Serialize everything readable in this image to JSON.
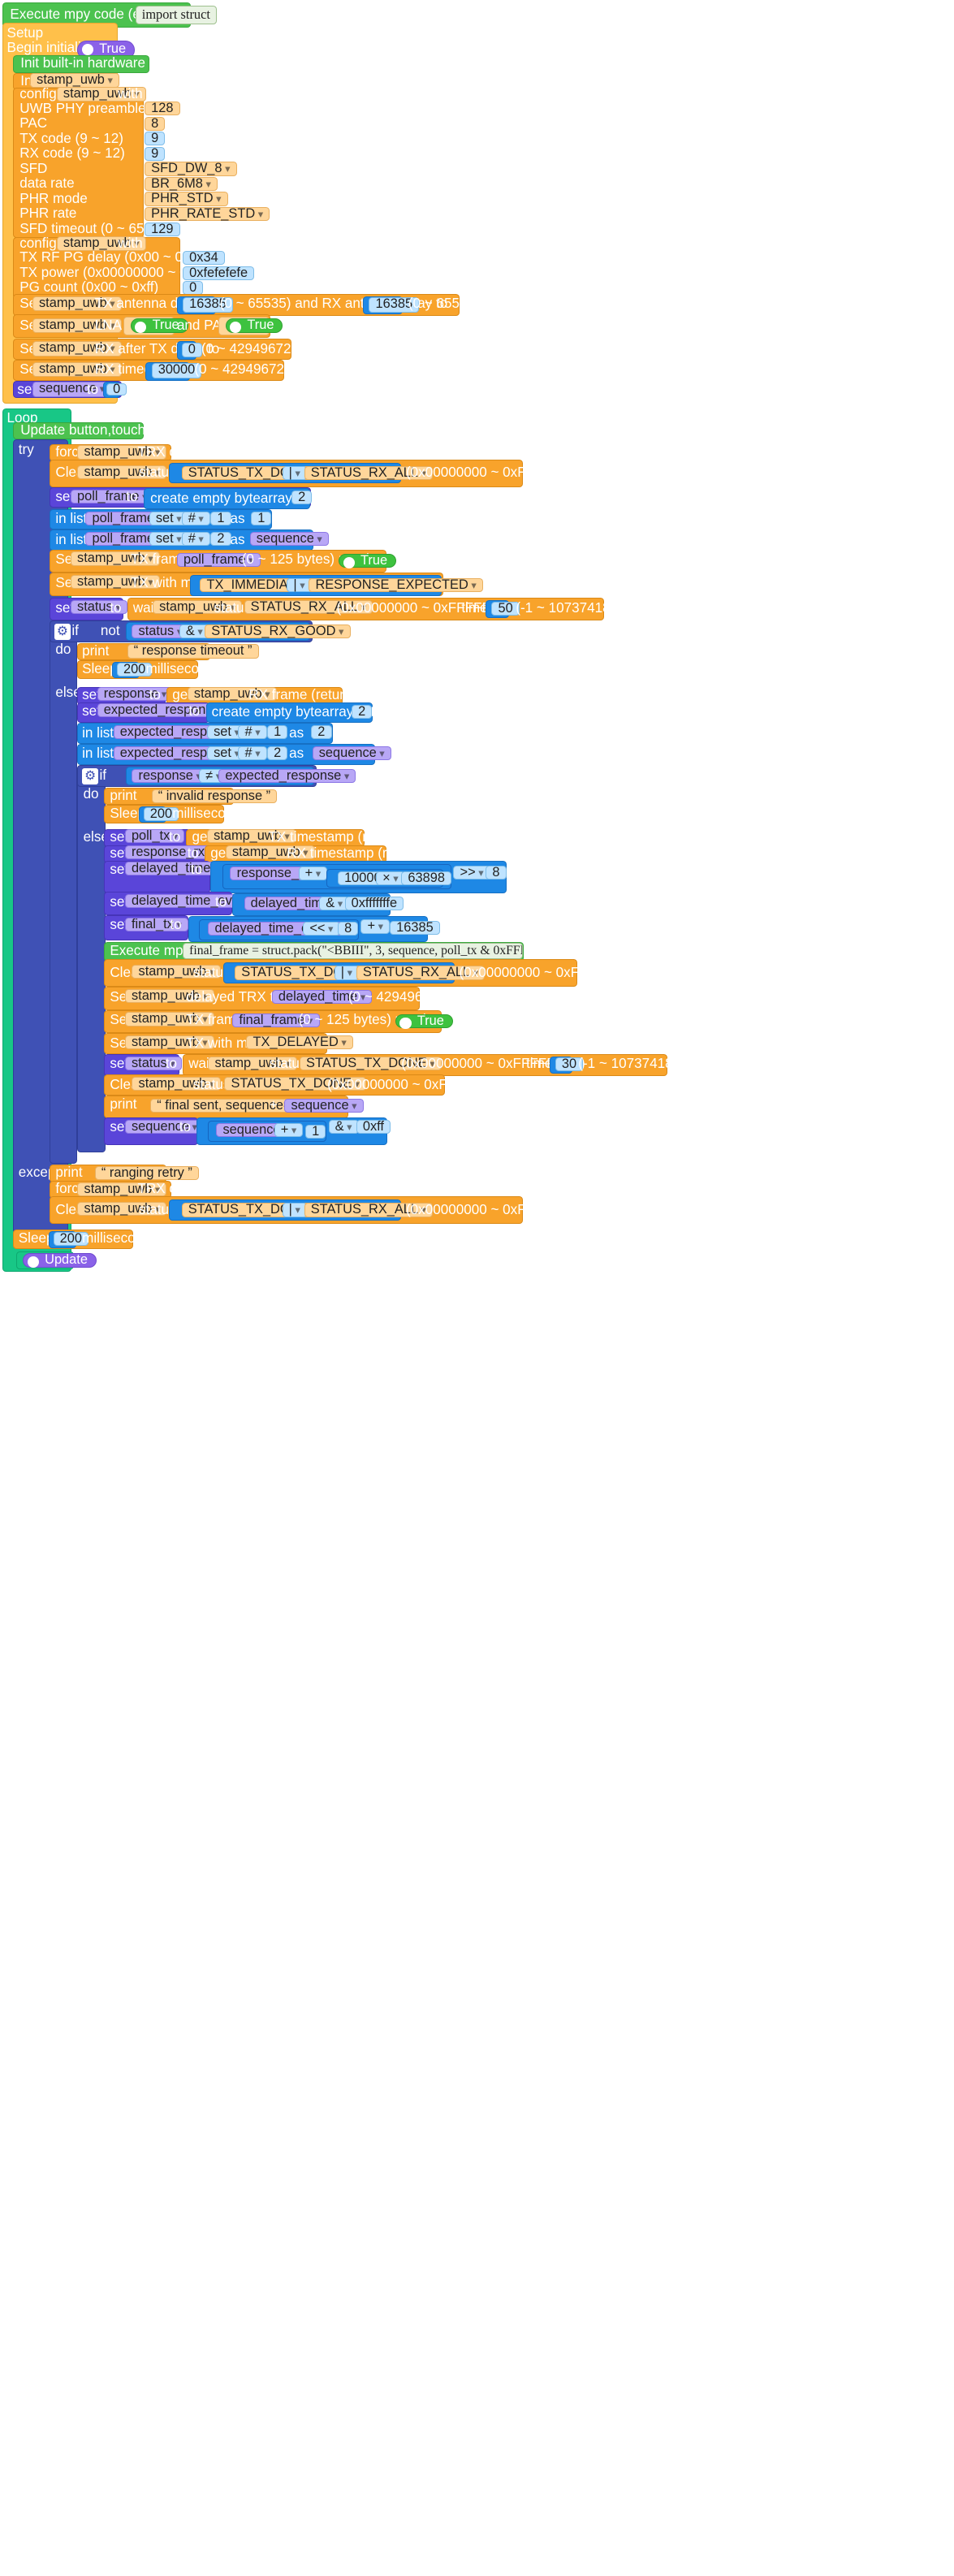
{
  "blocks": {
    "execTop": "Execute mpy code (e.g. import ...)",
    "execTopVal": "import struct",
    "setup": "Setup",
    "beginInit": "Begin initialization",
    "true": "True",
    "initHw": "Init built-in hardware at beginning",
    "init": "Init",
    "dev": "stamp_uwb",
    "configure": "configure",
    "with": "with",
    "c1": [
      [
        "UWB PHY preamble",
        "128"
      ],
      [
        "PAC",
        "8"
      ],
      [
        "TX code (9 ~ 12)",
        "9"
      ],
      [
        "RX code (9 ~ 12)",
        "9"
      ],
      [
        "SFD",
        "SFD_DW_8"
      ],
      [
        "data rate",
        "BR_6M8"
      ],
      [
        "PHR mode",
        "PHR_STD"
      ],
      [
        "PHR rate",
        "PHR_RATE_STD"
      ],
      [
        "SFD timeout (0 ~ 65535)",
        "129"
      ]
    ],
    "c2": [
      [
        "TX RF PG delay (0x00 ~ 0xff)",
        "0x34"
      ],
      [
        "TX power (0x00000000 ~ 0xFFFFFFFF)",
        "0xfefefefe"
      ],
      [
        "PG count (0x00 ~ 0xff)",
        "0"
      ]
    ],
    "set": "Set",
    "setl": "set",
    "to": "to",
    "txAnt": "TX antenna delay to",
    "v16385": "16385",
    "antRange": "(0 ~ 65535) and RX antenna delay to",
    "range65535": "(0 ~ 65535)",
    "lna": "LNA to",
    "andPa": "and PA to",
    "rxAfter": "RX after TX delay to",
    "v0": "0",
    "uusRange": "(0 ~ 4294967295 uus)",
    "rxTimeout": "RX timeout to",
    "v30000": "30000",
    "sequence": "sequence",
    "loop": "Loop",
    "updateLoop": "Update button,touch,etc. in loop",
    "try": "try",
    "force": "force",
    "trxOff": "TRX off",
    "clear": "Clear",
    "status": "status",
    "txDone": "STATUS_TX_DONE",
    "rxAll": "STATUS_RX_ALL",
    "bor": "|",
    "hexRange": "(0x00000000 ~ 0xFFFFFFFF)",
    "pollFrame": "poll_frame",
    "createBa": "create empty bytearray with length",
    "v2": "2",
    "inList": "in list",
    "setOp": "set",
    "hash": "#",
    "v1": "1",
    "as": "as",
    "txFrame": "TX frame",
    "txFrameRange": "(0 ~ 125 bytes) ranging",
    "txMode": "TX with mode",
    "txImm": "TX_IMMEDIATE",
    "respExp": "RESPONSE_EXPECTED",
    "statusVar": "status",
    "wait": "wait",
    "timeout": "timeout",
    "v50": "50",
    "msRange": "(-1 ~ 1073741823 ms)",
    "if": "if",
    "not": "not",
    "amp": "&",
    "rxGood": "STATUS_RX_GOOD",
    "do": "do",
    "print": "print",
    "respTimeout": "response timeout",
    "sleep": "Sleep",
    "v200": "200",
    "ms": "milliseconds",
    "else": "else",
    "response": "response",
    "get": "get",
    "rxFrame": "RX frame (return bytes)",
    "expResp": "expected_response",
    "neq": "≠",
    "invalidResp": "invalid response",
    "pollTx": "poll_tx",
    "txTs": "TX timestamp (return int)",
    "respRx": "response_rx",
    "rxTs": "RX timestamp (return int)",
    "delayed": "delayed_time",
    "plus": "+",
    "v10000": "10000",
    "times": "×",
    "v63898": "63898",
    "shr": ">>",
    "v8": "8",
    "delayedEven": "delayed_time_even",
    "vMask": "0xfffffffe",
    "finalTx": "final_tx",
    "shl": "<<",
    "execMpy": "Execute mpy code",
    "execCode": "final_frame = struct.pack(\"<BBIII\", 3, sequence, poll_tx & 0xFFFFFFFF, response_rx & 0...",
    "delayedTrx": "delayed TRX time to",
    "trxRange": "(0 ~ 4294967295)",
    "finalFrame": "final_frame",
    "txDelayed": "TX_DELAYED",
    "v30": "30",
    "finalSent": "final sent, sequence=",
    "vff": "0xff",
    "except": "except",
    "rangingRetry": "ranging retry",
    "update": "Update"
  }
}
